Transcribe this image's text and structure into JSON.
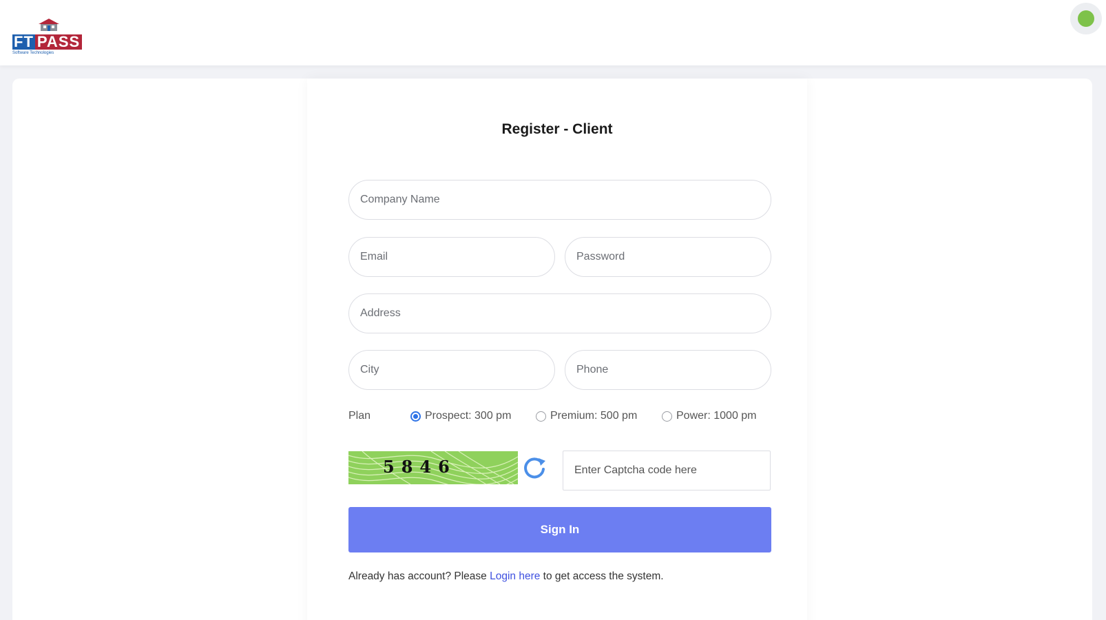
{
  "header": {
    "logo": {
      "text_primary": "FT",
      "text_secondary": "PASS",
      "tagline": "Software Technologies",
      "colors": {
        "blue": "#1d5fae",
        "red": "#b3263a"
      }
    },
    "status_indicator_color": "#7ec24a"
  },
  "form": {
    "title": "Register - Client",
    "fields": {
      "company_name": {
        "placeholder": "Company Name",
        "value": ""
      },
      "email": {
        "placeholder": "Email",
        "value": ""
      },
      "password": {
        "placeholder": "Password",
        "value": ""
      },
      "address": {
        "placeholder": "Address",
        "value": ""
      },
      "city": {
        "placeholder": "City",
        "value": ""
      },
      "phone": {
        "placeholder": "Phone",
        "value": ""
      }
    },
    "plan": {
      "label": "Plan",
      "options": [
        {
          "label": "Prospect: 300 pm",
          "selected": true
        },
        {
          "label": "Premium: 500 pm",
          "selected": false
        },
        {
          "label": "Power: 1000 pm",
          "selected": false
        }
      ]
    },
    "captcha": {
      "code": "5846",
      "refresh_icon": "refresh-icon",
      "input_placeholder": "Enter Captcha code here"
    },
    "submit_label": "Sign In",
    "footer": {
      "prefix": "Already has account? Please",
      "link": "Login here",
      "suffix": "to get access the system."
    },
    "accent_color": "#6c7ef2"
  }
}
